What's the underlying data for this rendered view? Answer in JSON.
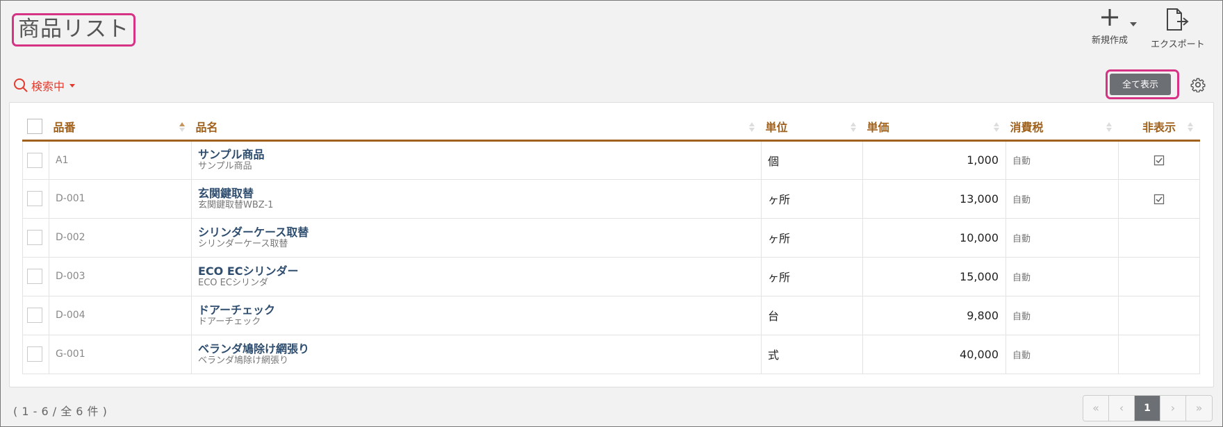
{
  "page": {
    "title": "商品リスト"
  },
  "toolbar": {
    "new_label": "新規作成",
    "export_label": "エクスポート"
  },
  "search": {
    "label": "検索中"
  },
  "actions": {
    "show_all_label": "全て表示"
  },
  "table": {
    "headers": {
      "code": "品番",
      "name": "品名",
      "unit": "単位",
      "price": "単価",
      "tax": "消費税",
      "hidden": "非表示"
    },
    "rows": [
      {
        "code": "A1",
        "name": "サンプル商品",
        "subname": "サンプル商品",
        "unit": "個",
        "price": "1,000",
        "tax": "自動",
        "hidden": true
      },
      {
        "code": "D-001",
        "name": "玄関鍵取替",
        "subname": "玄関鍵取替WBZ-1",
        "unit": "ヶ所",
        "price": "13,000",
        "tax": "自動",
        "hidden": true
      },
      {
        "code": "D-002",
        "name": "シリンダーケース取替",
        "subname": "シリンダーケース取替",
        "unit": "ヶ所",
        "price": "10,000",
        "tax": "自動",
        "hidden": false
      },
      {
        "code": "D-003",
        "name": "ECO ECシリンダー",
        "subname": "ECO ECシリンダ",
        "unit": "ヶ所",
        "price": "15,000",
        "tax": "自動",
        "hidden": false
      },
      {
        "code": "D-004",
        "name": "ドアーチェック",
        "subname": "ドアーチェック",
        "unit": "台",
        "price": "9,800",
        "tax": "自動",
        "hidden": false
      },
      {
        "code": "G-001",
        "name": "ベランダ鳩除け網張り",
        "subname": "ベランダ鳩除け網張り",
        "unit": "式",
        "price": "40,000",
        "tax": "自動",
        "hidden": false
      }
    ]
  },
  "footer": {
    "count_text": "( 1 - 6 / 全 6 件 )"
  },
  "pagination": {
    "first": "«",
    "prev": "‹",
    "current": "1",
    "next": "›",
    "last": "»"
  },
  "colors": {
    "accent_pink": "#d63384",
    "header_brown": "#a0611d",
    "search_red": "#e23b2e",
    "button_gray": "#6c6f73"
  }
}
